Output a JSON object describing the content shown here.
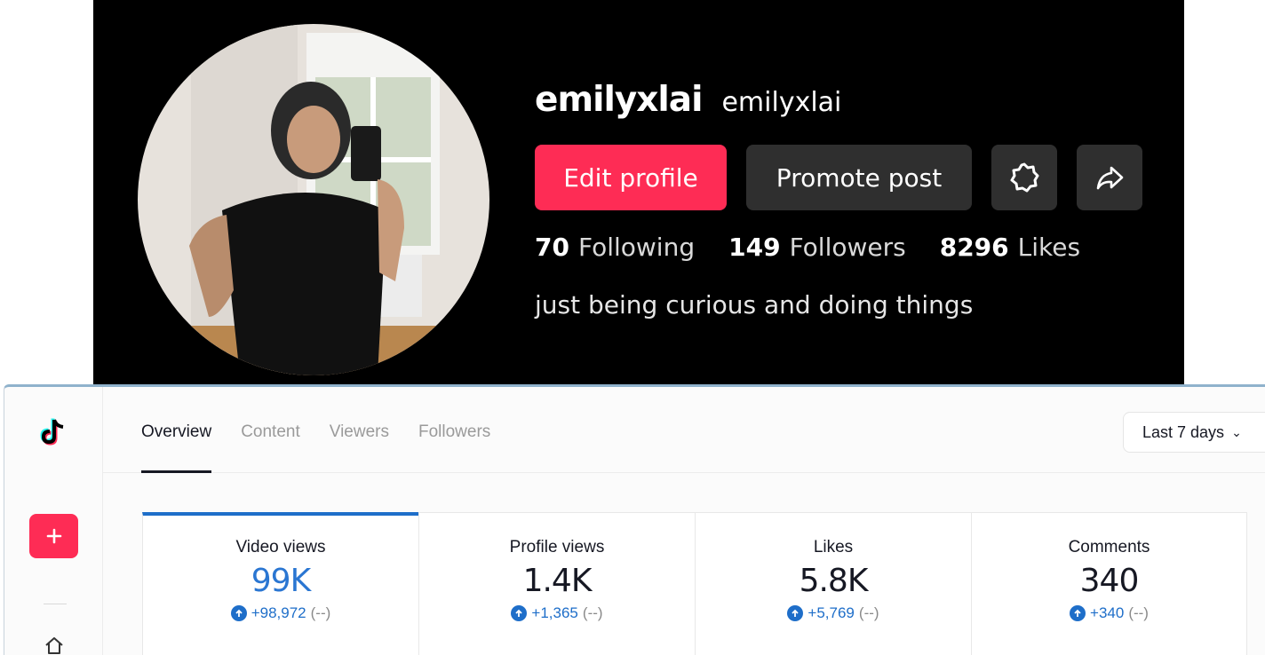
{
  "profile": {
    "display_name": "emilyxlai",
    "handle": "emilyxlai",
    "buttons": {
      "edit": "Edit profile",
      "promote": "Promote post"
    },
    "stats": [
      {
        "value": "70",
        "label": "Following"
      },
      {
        "value": "149",
        "label": "Followers"
      },
      {
        "value": "8296",
        "label": "Likes"
      }
    ],
    "bio": "just being curious and doing things"
  },
  "analytics": {
    "tabs": [
      "Overview",
      "Content",
      "Viewers",
      "Followers"
    ],
    "active_tab": "Overview",
    "date_range": "Last 7 days",
    "cards": [
      {
        "title": "Video views",
        "value": "99K",
        "change": "+98,972",
        "previous": "(--)"
      },
      {
        "title": "Profile views",
        "value": "1.4K",
        "change": "+1,365",
        "previous": "(--)"
      },
      {
        "title": "Likes",
        "value": "5.8K",
        "change": "+5,769",
        "previous": "(--)"
      },
      {
        "title": "Comments",
        "value": "340",
        "change": "+340",
        "previous": "(--)"
      }
    ]
  },
  "icons": {
    "settings": "gear-icon",
    "share": "share-icon",
    "logo": "tiktok-logo-icon",
    "add": "plus-icon",
    "home": "home-icon",
    "increase": "arrow-up-circle-icon"
  },
  "colors": {
    "accent_red": "#fe2c55",
    "accent_blue": "#1e6ec9",
    "panel_bg": "#000000"
  }
}
